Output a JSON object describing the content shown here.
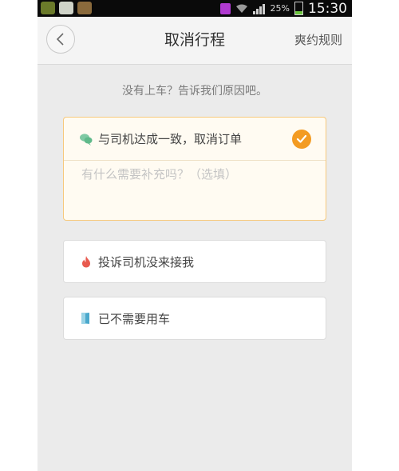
{
  "status_bar": {
    "battery_percent": "25%",
    "time": "15:30"
  },
  "header": {
    "title": "取消行程",
    "rules_link": "爽约规则"
  },
  "prompt": "没有上车？告诉我们原因吧。",
  "options": [
    {
      "label": "与司机达成一致，取消订单",
      "icon": "chat-bubble-icon",
      "selected": true,
      "note_placeholder": "有什么需要补充吗？（选填）"
    },
    {
      "label": "投诉司机没来接我",
      "icon": "flame-icon",
      "selected": false
    },
    {
      "label": "已不需要用车",
      "icon": "door-icon",
      "selected": false
    }
  ],
  "colors": {
    "accent": "#f39b22",
    "selected_border": "#f7c97c",
    "background": "#ebebeb"
  }
}
